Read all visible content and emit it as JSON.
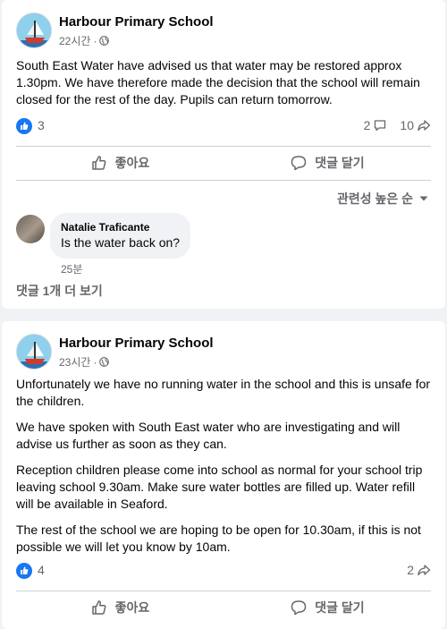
{
  "posts": [
    {
      "page_name": "Harbour Primary School",
      "time": "22시간",
      "privacy_icon": "globe-icon",
      "paragraphs": [
        "South East Water have advised us that water may be restored approx 1.30pm. We have therefore made the decision that the school will remain closed for the rest of the day. Pupils can return tomorrow."
      ],
      "reactions_count": "3",
      "comments_count": "2",
      "shares_count": "10",
      "like_label": "좋아요",
      "comment_label": "댓글 달기",
      "sort_label": "관련성 높은 순",
      "comment": {
        "author": "Natalie Traficante",
        "text": "Is the water back on?",
        "time": "25분"
      },
      "more_comments_label": "댓글 1개 더 보기"
    },
    {
      "page_name": "Harbour Primary School",
      "time": "23시간",
      "privacy_icon": "globe-icon",
      "paragraphs": [
        "Unfortunately we have no running water in the school and this is unsafe for the children.",
        "We have spoken with South East water who are investigating and will advise us further as soon as they can.",
        "Reception children please come into school as normal for your school trip leaving school 9.30am. Make sure water bottles are filled up. Water refill will be available in Seaford.",
        "The rest of the school we are hoping to be open for 10.30am, if this is not possible we will let you know by 10am."
      ],
      "reactions_count": "4",
      "shares_count": "2",
      "like_label": "좋아요",
      "comment_label": "댓글 달기"
    }
  ],
  "colors": {
    "accent": "#1877f2",
    "secondary_text": "#65676b",
    "bubble": "#f0f2f5"
  }
}
